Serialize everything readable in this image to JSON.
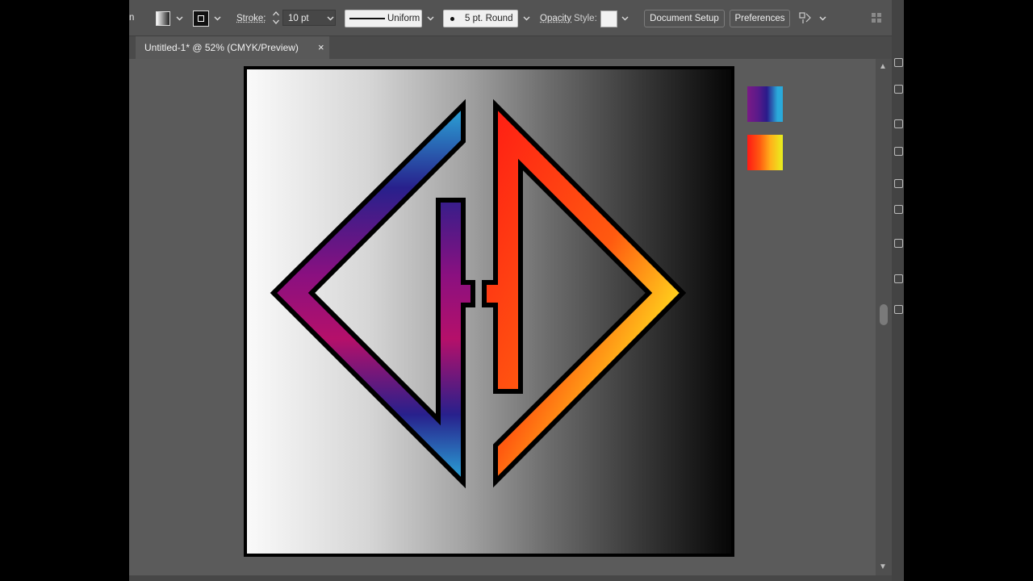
{
  "control_bar": {
    "stroke_label": "Stroke:",
    "stroke_weight": "10 pt",
    "stroke_profile": "Uniform",
    "brush_definition": "5 pt. Round",
    "opacity_label": "Opacity",
    "style_label": "Style:",
    "document_setup_label": "Document Setup",
    "preferences_label": "Preferences"
  },
  "document_tab": {
    "title": "Untitled-1* @ 52% (CMYK/Preview)",
    "close_symbol": "×"
  },
  "artwork": {
    "left_shape_gradient": [
      "#8a1080",
      "#b5106a",
      "#28208c",
      "#2aa9da"
    ],
    "right_shape_gradient": [
      "#ff1a14",
      "#ff6a10",
      "#ffd21c",
      "#d8f01e"
    ],
    "artboard_gradient": [
      "#fafafa",
      "#060606"
    ]
  },
  "swatches": [
    {
      "name": "purple-blue-gradient",
      "colors": [
        "#7a1a86",
        "#2a1a8a",
        "#2aa9da"
      ]
    },
    {
      "name": "red-yellow-gradient",
      "colors": [
        "#ff1a14",
        "#ff8a10",
        "#e8f01e"
      ]
    }
  ]
}
